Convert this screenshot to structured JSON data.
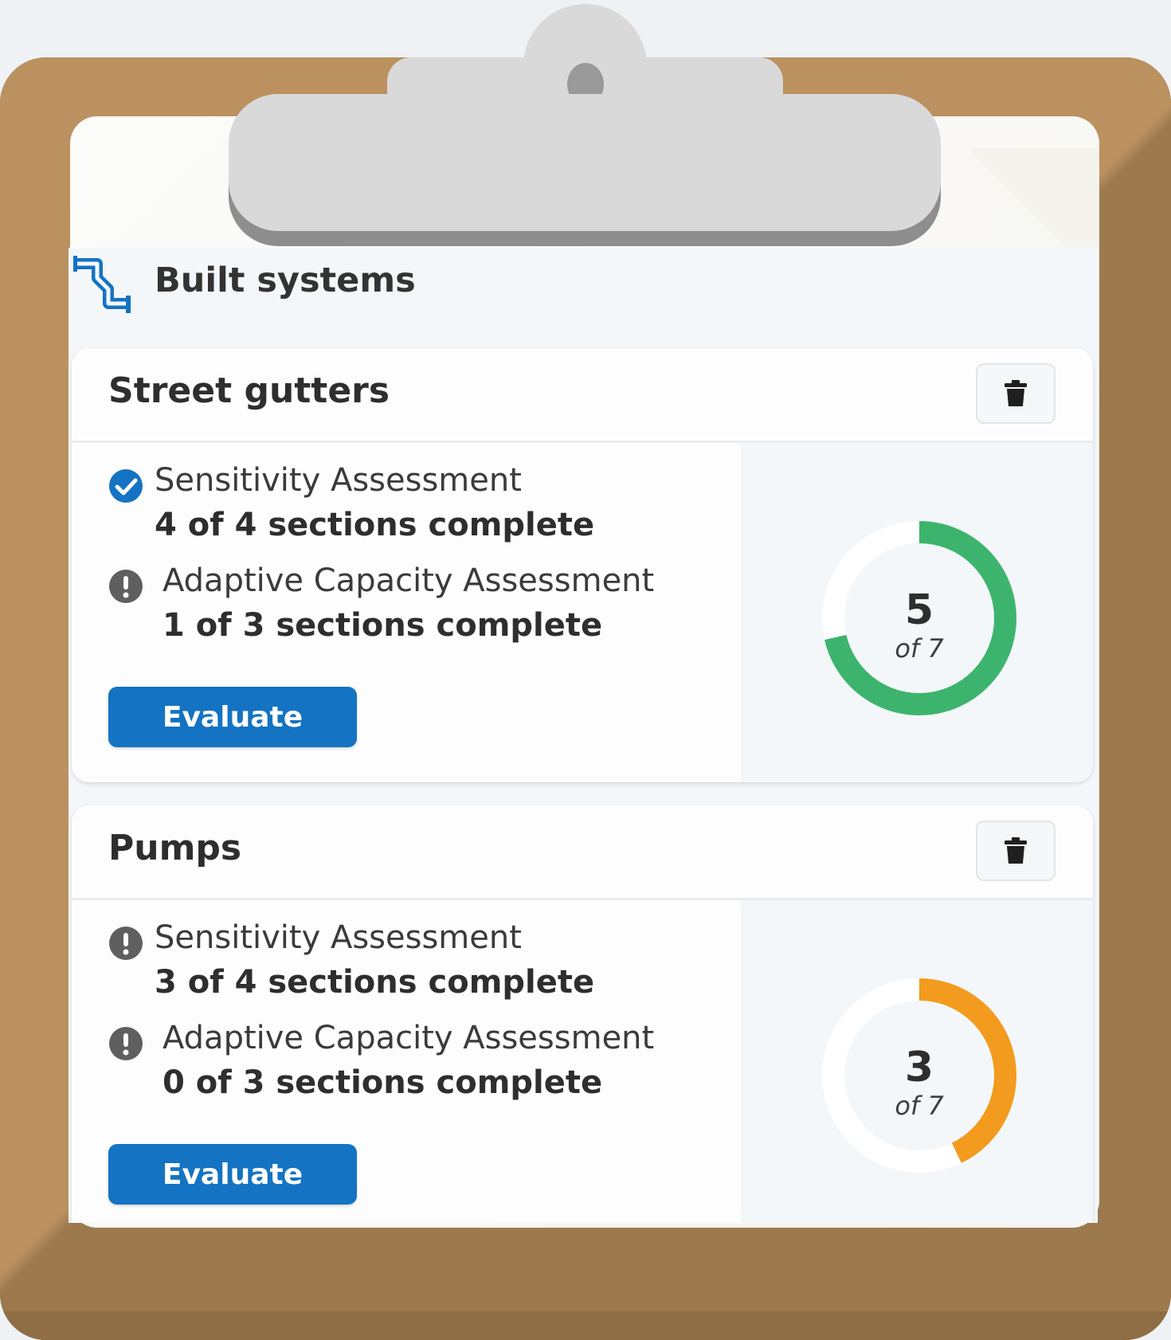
{
  "section": {
    "title": "Built systems",
    "icon": "pipes-icon"
  },
  "colors": {
    "accent": "#1473c2",
    "complete": "#3db46d",
    "partial": "#f29b1e",
    "incomplete": "#5f5f5f"
  },
  "cards": [
    {
      "title": "Street gutters",
      "delete_icon": "trash-icon",
      "assessments": [
        {
          "name": "Sensitivity Assessment",
          "progress": "4 of 4 sections complete",
          "status": "complete",
          "icon": "check-circle-icon"
        },
        {
          "name": "Adaptive Capacity Assessment",
          "progress": "1 of 3 sections complete",
          "status": "incomplete",
          "icon": "exclamation-circle-icon"
        }
      ],
      "button_label": "Evaluate",
      "ring": {
        "value": "5",
        "of": "of 7",
        "completed": 5,
        "total": 7,
        "color": "#3db46d"
      }
    },
    {
      "title": "Pumps",
      "delete_icon": "trash-icon",
      "assessments": [
        {
          "name": "Sensitivity Assessment",
          "progress": "3 of 4 sections complete",
          "status": "incomplete",
          "icon": "exclamation-circle-icon"
        },
        {
          "name": "Adaptive Capacity Assessment",
          "progress": "0 of 3 sections complete",
          "status": "incomplete",
          "icon": "exclamation-circle-icon"
        }
      ],
      "button_label": "Evaluate",
      "ring": {
        "value": "3",
        "of": "of 7",
        "completed": 3,
        "total": 7,
        "color": "#f29b1e"
      }
    }
  ]
}
